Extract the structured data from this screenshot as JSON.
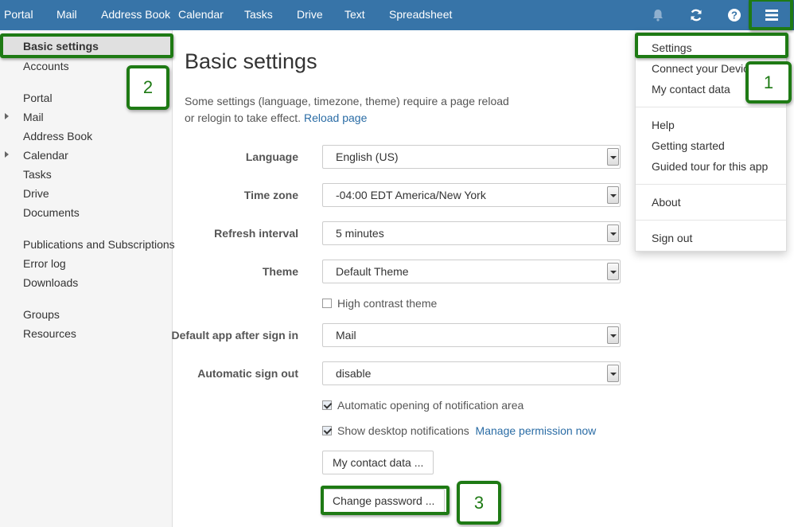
{
  "topbar": {
    "nav": [
      "Portal",
      "Mail",
      "Address Book",
      "Calendar",
      "Tasks",
      "Drive",
      "Text",
      "Spreadsheet"
    ],
    "icons": [
      "bell-icon",
      "refresh-icon",
      "help-icon",
      "menu-icon"
    ],
    "color": "#3774a8"
  },
  "sidebar": {
    "active": "Basic settings",
    "accounts": "Accounts",
    "apps": [
      "Portal",
      "Mail",
      "Address Book",
      "Calendar",
      "Tasks",
      "Drive",
      "Documents"
    ],
    "misc": [
      "Publications and Subscriptions",
      "Error log",
      "Downloads"
    ],
    "admin": [
      "Groups",
      "Resources"
    ]
  },
  "main": {
    "title": "Basic settings",
    "desc_line1": "Some settings (language, timezone, theme) require a page reload",
    "desc_line2": "or relogin to take effect.",
    "reload_link": "Reload page",
    "language_label": "Language",
    "language_value": "English (US)",
    "timezone_label": "Time zone",
    "timezone_value": "-04:00 EDT America/New York",
    "refresh_label": "Refresh interval",
    "refresh_value": "5 minutes",
    "theme_label": "Theme",
    "theme_value": "Default Theme",
    "high_contrast": "High contrast theme",
    "default_app_label": "Default app after sign in",
    "default_app_value": "Mail",
    "auto_signout_label": "Automatic sign out",
    "auto_signout_value": "disable",
    "auto_open_notif": "Automatic opening of notification area",
    "desktop_notif": "Show desktop notifications",
    "manage_perm": "Manage permission now",
    "contact_btn": "My contact data ...",
    "password_btn": "Change password ..."
  },
  "menu": {
    "group1": [
      "Settings",
      "Connect your Device",
      "My contact data"
    ],
    "group2": [
      "Help",
      "Getting started",
      "Guided tour for this app"
    ],
    "group3": [
      "About"
    ],
    "group4": [
      "Sign out"
    ]
  },
  "annotations": {
    "badge1": "1",
    "badge2": "2",
    "badge3": "3",
    "color": "#1e7a14"
  }
}
